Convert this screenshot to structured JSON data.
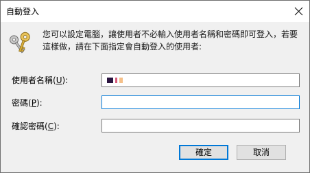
{
  "window": {
    "title": "自動登入",
    "close_label": "×"
  },
  "description": "您可以設定電腦，讓使用者不必輸入使用者名稱和密碼即可登入，若要這樣做，請在下面指定會自動登入的使用者:",
  "fields": {
    "username": {
      "label_prefix": "使用者名稱(",
      "label_accel": "U",
      "label_suffix": "):",
      "value_obscured": true
    },
    "password": {
      "label_prefix": "密碼(",
      "label_accel": "P",
      "label_suffix": "):",
      "value": ""
    },
    "confirm": {
      "label_prefix": "確認密碼(",
      "label_accel": "C",
      "label_suffix": "):",
      "value": ""
    }
  },
  "buttons": {
    "ok": "確定",
    "cancel": "取消"
  },
  "colors": {
    "focus_border": "#0078d7",
    "button_face": "#e1e1e1",
    "dialog_background": "#f0f0f0"
  },
  "icons": {
    "dialog": "keys-icon",
    "close": "close-icon"
  }
}
